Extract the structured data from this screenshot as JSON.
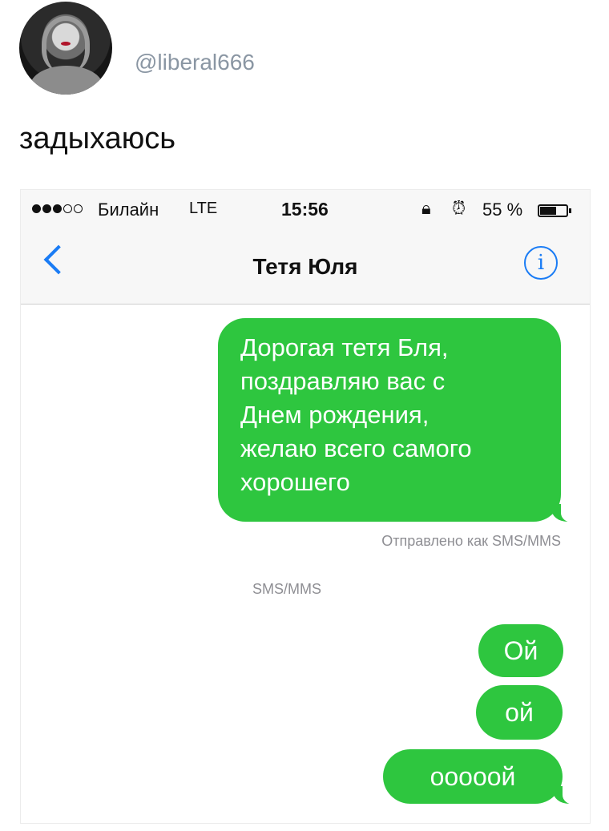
{
  "post": {
    "username": "@liberal666",
    "text": "задыхаюсь"
  },
  "status_bar": {
    "carrier": "Билайн",
    "network": "LTE",
    "time": "15:56",
    "battery": "55 %",
    "icons": [
      "signal-dots",
      "lock-rotation-icon",
      "alarm-icon",
      "battery-icon"
    ]
  },
  "nav": {
    "title": "Тетя Юля",
    "info_glyph": "i",
    "icons": [
      "back-chevron-icon",
      "info-icon"
    ]
  },
  "messages": {
    "first": "Дорогая тетя Бля, поздравляю вас с Днем рождения, желаю всего самого хорошего",
    "first_lines": [
      "Дорогая тетя Бля,",
      "поздравляю вас с",
      "Днем рождения,",
      "желаю всего самого",
      "хорошего"
    ],
    "delivered_note": "Отправлено как SMS/MMS",
    "service_label": "SMS/MMS",
    "reply1": "Ой",
    "reply2": "ой",
    "reply3": "ооооой"
  },
  "colors": {
    "bubble": "#2ec63f",
    "accent": "#1a7cf5",
    "username": "#8a96a3"
  }
}
